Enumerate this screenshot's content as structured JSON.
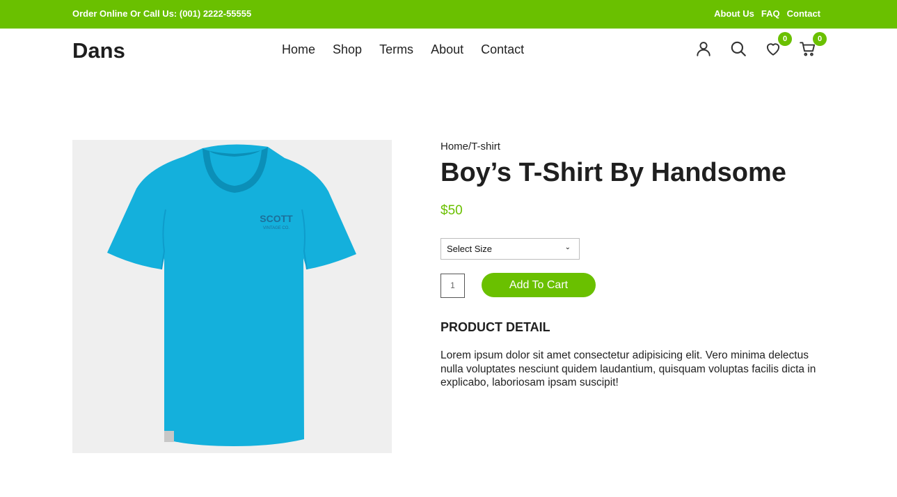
{
  "topbar": {
    "promo": "Order Online Or Call Us: (001) 2222-55555",
    "links": [
      "About Us",
      "FAQ",
      "Contact"
    ]
  },
  "header": {
    "logo": "Dans",
    "nav": [
      "Home",
      "Shop",
      "Terms",
      "About",
      "Contact"
    ],
    "icons": [
      "user-icon",
      "search-icon",
      "heart-icon",
      "cart-icon"
    ],
    "wishlist_count": "0",
    "cart_count": "0"
  },
  "product": {
    "breadcrumb_home": "Home",
    "breadcrumb_sep": "/",
    "breadcrumb_category": "T-shirt",
    "title": "Boy’s T-Shirt By Handsome",
    "price": "$50",
    "size_select": "Select Size",
    "quantity": "1",
    "add_to_cart": "Add To Cart",
    "detail_heading": "PRODUCT DETAIL",
    "detail_text": "Lorem ipsum dolor sit amet consectetur adipisicing elit. Vero minima delectus nulla voluptates nesciunt quidem laudantium, quisquam voluptas facilis dicta in explicabo, laboriosam ipsam suscipit!",
    "shirt_print": "SCOTT",
    "shirt_print_sub": "VINTAGE CO."
  },
  "colors": {
    "accent": "#6ac000",
    "shirt": "#14b0dc",
    "image_bg": "#efefef"
  }
}
